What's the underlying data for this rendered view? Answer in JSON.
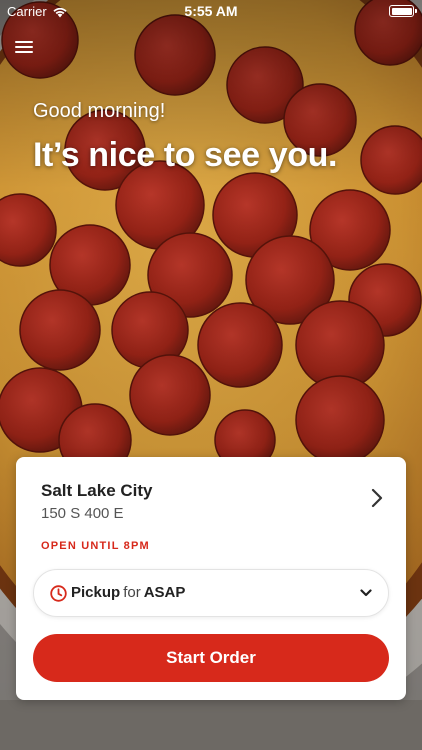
{
  "status_bar": {
    "carrier": "Carrier",
    "time": "5:55 AM",
    "icons": [
      "wifi-icon",
      "battery-icon"
    ]
  },
  "header": {
    "menu_icon": "hamburger-menu-icon"
  },
  "hero": {
    "greeting": "Good morning!",
    "headline": "It’s nice to see you."
  },
  "store": {
    "name": "Salt Lake City",
    "address": "150 S 400 E",
    "hours": "OPEN UNTIL 8PM",
    "chevron_icon": "chevron-right-icon"
  },
  "order_type": {
    "method": "Pickup",
    "connector": "for",
    "time": "ASAP",
    "icon": "clock-icon",
    "dropdown_icon": "chevron-down-icon"
  },
  "actions": {
    "start_order_label": "Start Order"
  },
  "colors": {
    "accent": "#d7291b",
    "card_background": "#ffffff",
    "text_primary": "#222222"
  }
}
